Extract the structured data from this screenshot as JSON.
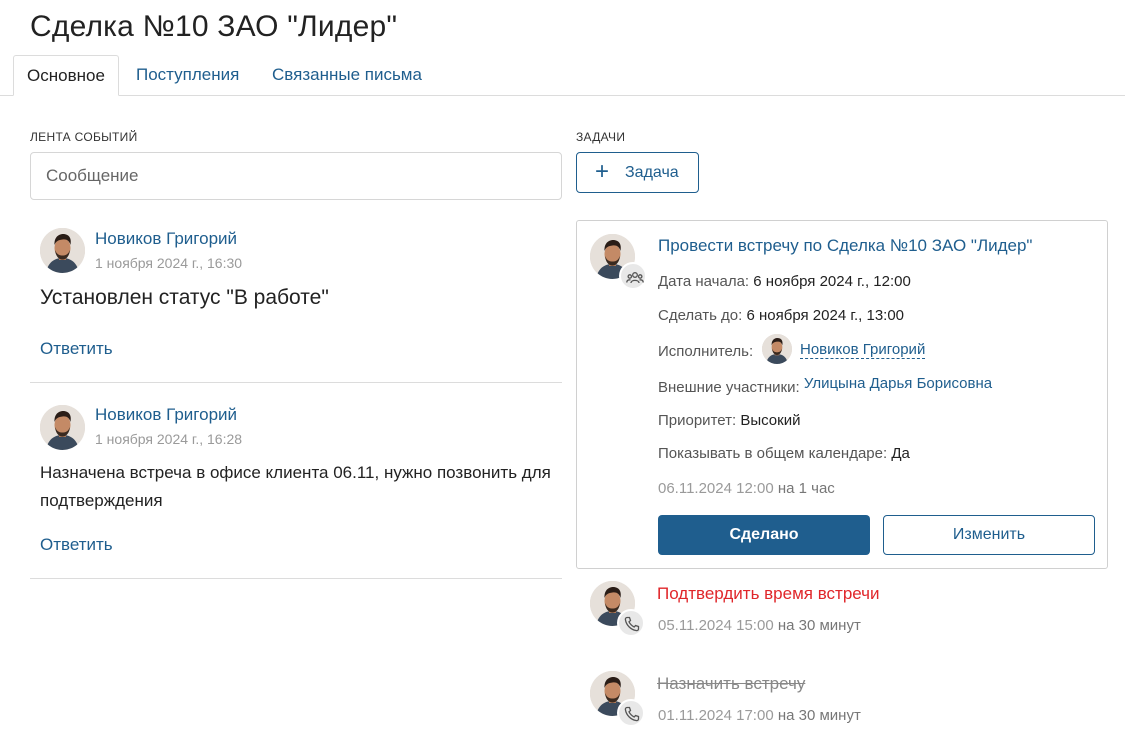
{
  "page": {
    "title": "Сделка №10 ЗАО \"Лидер\""
  },
  "tabs": [
    {
      "label": "Основное",
      "active": true
    },
    {
      "label": "Поступления",
      "active": false
    },
    {
      "label": "Связанные письма",
      "active": false
    }
  ],
  "feed": {
    "label": "ЛЕНТА СОБЫТИЙ",
    "input_placeholder": "Сообщение",
    "reply_label": "Ответить",
    "posts": [
      {
        "author": "Новиков Григорий",
        "time": "1 ноября 2024 г., 16:30",
        "text": "Установлен статус \"В работе\""
      },
      {
        "author": "Новиков Григорий",
        "time": "1 ноября 2024 г., 16:28",
        "text": "Назначена встреча в офисе клиента 06.11, нужно позвонить для подтверждения"
      }
    ]
  },
  "tasks": {
    "label": "ЗАДАЧИ",
    "add_button": "Задача",
    "open_task": {
      "title": "Провести встречу по Сделка №10 ЗАО \"Лидер\"",
      "start_label": "Дата начала:",
      "start_value": "6 ноября 2024 г., 12:00",
      "due_label": "Сделать до:",
      "due_value": "6 ноября 2024 г., 13:00",
      "assignee_label": "Исполнитель:",
      "assignee_value": "Новиков Григорий",
      "external_label": "Внешние участники:",
      "external_value": "Улицына Дарья Борисовна",
      "priority_label": "Приоритет:",
      "priority_value": "Высокий",
      "calendar_label": "Показывать в общем календаре:",
      "calendar_value": "Да",
      "schedule_date": "06.11.2024 12:00",
      "schedule_duration": "на 1 час",
      "done_button": "Сделано",
      "edit_button": "Изменить",
      "type_icon": "group-icon"
    },
    "other_tasks": [
      {
        "title": "Подтвердить время встречи",
        "date": "05.11.2024 15:00",
        "duration": "на 30 минут",
        "status": "overdue",
        "color": "#e0262a",
        "type_icon": "phone-icon"
      },
      {
        "title": "Назначить встречу",
        "date": "01.11.2024 17:00",
        "duration": "на 30 минут",
        "status": "completed",
        "type_icon": "phone-icon"
      }
    ]
  },
  "colors": {
    "accent": "#1f5e8e",
    "danger": "#e0262a",
    "muted": "#9a9a9a",
    "border": "#dcdcdc"
  }
}
